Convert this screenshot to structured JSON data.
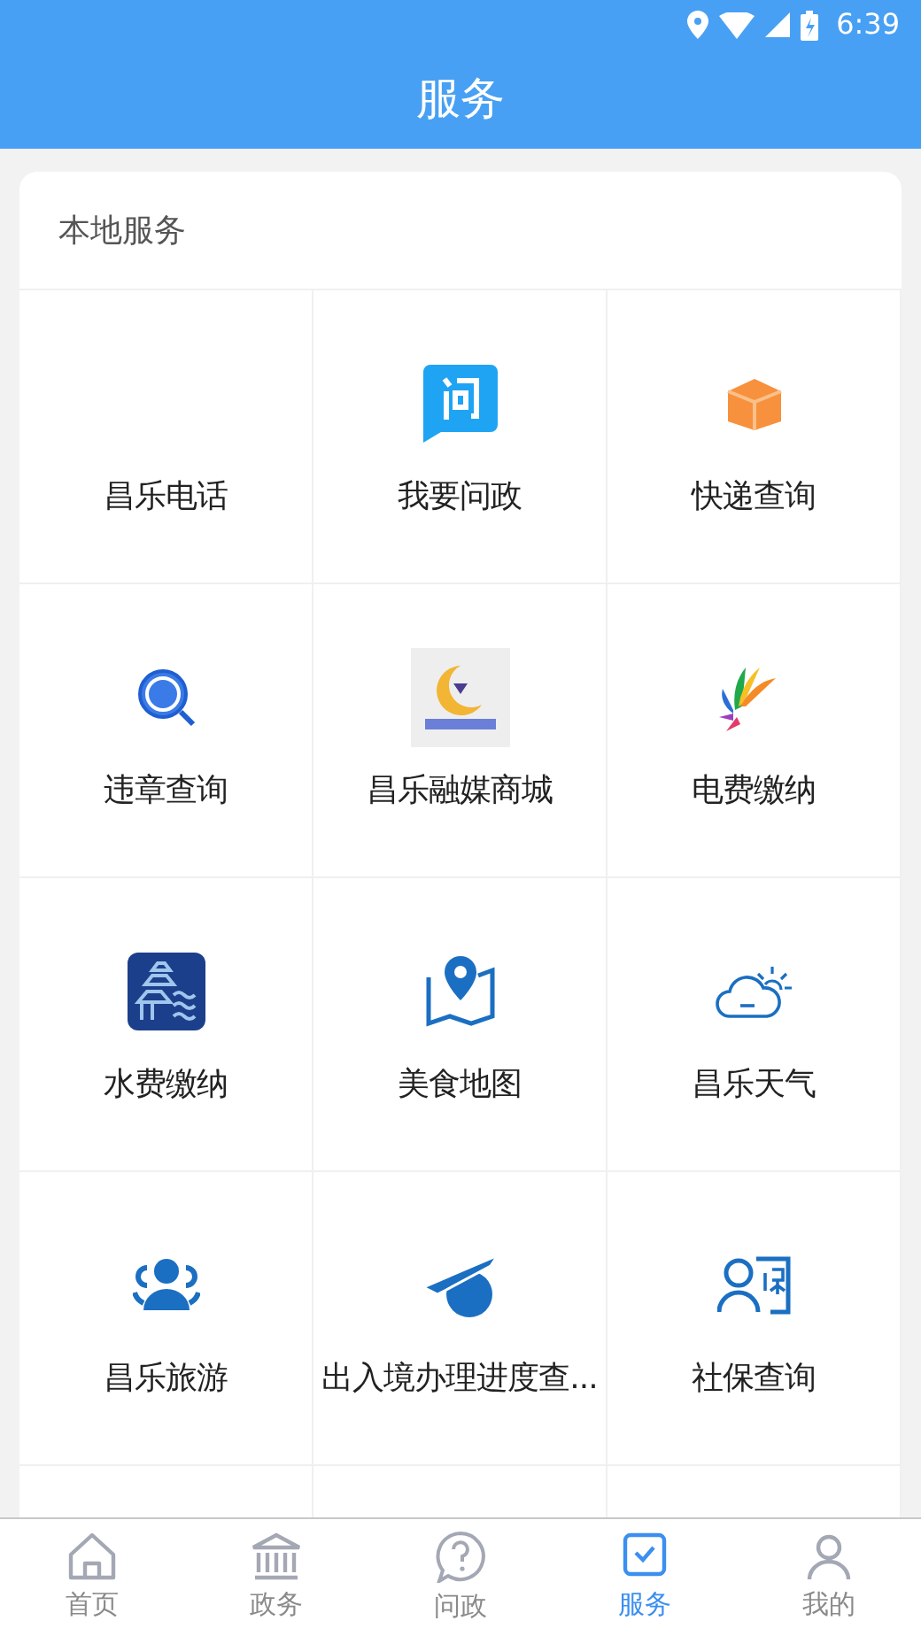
{
  "status_bar": {
    "time": "6:39"
  },
  "header": {
    "title": "服务"
  },
  "section": {
    "title": "本地服务",
    "items": [
      {
        "label": "昌乐电话"
      },
      {
        "label": "我要问政"
      },
      {
        "label": "快递查询"
      },
      {
        "label": "违章查询"
      },
      {
        "label": "昌乐融媒商城"
      },
      {
        "label": "电费缴纳"
      },
      {
        "label": "水费缴纳"
      },
      {
        "label": "美食地图"
      },
      {
        "label": "昌乐天气"
      },
      {
        "label": "昌乐旅游"
      },
      {
        "label": "出入境办理进度查..."
      },
      {
        "label": "社保查询"
      }
    ]
  },
  "tab_bar": [
    {
      "label": "首页",
      "selected": false
    },
    {
      "label": "政务",
      "selected": false
    },
    {
      "label": "问政",
      "selected": false
    },
    {
      "label": "服务",
      "selected": true
    },
    {
      "label": "我的",
      "selected": false
    }
  ]
}
